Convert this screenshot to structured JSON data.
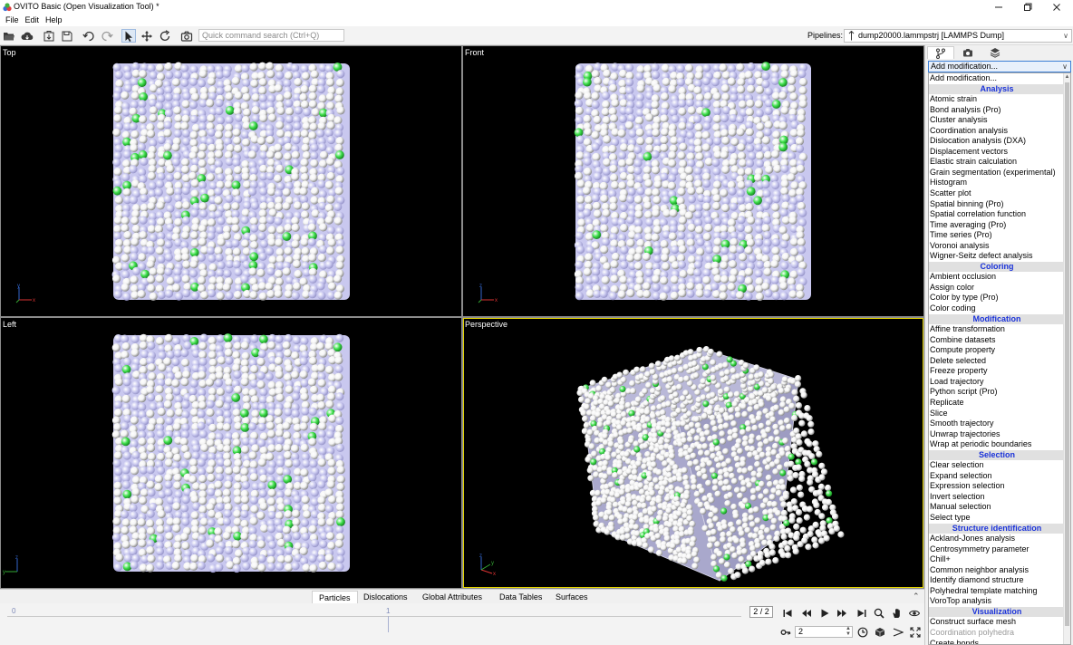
{
  "window": {
    "title": "OVITO Basic (Open Visualization Tool) *",
    "minimize_icon": "minimize-icon",
    "maximize_icon": "maximize-icon",
    "close_icon": "close-icon"
  },
  "menu": [
    "File",
    "Edit",
    "Help"
  ],
  "toolbar": {
    "icons": [
      "open-file-icon",
      "load-remote-icon",
      "export-icon",
      "save-session-icon",
      "undo-icon",
      "redo-icon",
      "select-mode-icon",
      "pan-mode-icon",
      "orbit-mode-icon",
      "render-icon"
    ],
    "search_placeholder": "Quick command search (Ctrl+Q)",
    "pipelines_label": "Pipelines:",
    "pipeline_value": "dump20000.lammpstrj [LAMMPS Dump]"
  },
  "viewports": [
    {
      "caption": "Top",
      "active": false
    },
    {
      "caption": "Front",
      "active": false
    },
    {
      "caption": "Left",
      "active": false
    },
    {
      "caption": "Perspective",
      "active": true
    }
  ],
  "colors": {
    "active_viewport_border": "#e5d600",
    "atom_white": "#f4f4f4",
    "atom_green": "#3ee04b",
    "atom_lavender": "#c9c8ef",
    "viewport_bg": "#000000",
    "category_text": "#1a32d9"
  },
  "inspector_tabs": [
    "Particles",
    "Dislocations",
    "Global Attributes",
    "Data Tables",
    "Surfaces"
  ],
  "inspector_active_tab": "Particles",
  "timeline": {
    "tick_start": "0",
    "tick_end": "1",
    "frame_display": "2 / 2",
    "frame_value": "2"
  },
  "panel": {
    "tab_icons": [
      "pipeline-icon",
      "render-tab-icon",
      "layers-icon"
    ],
    "modifier_select": "Add modification...",
    "list": [
      {
        "label": "Add modification...",
        "type": "item"
      },
      {
        "label": "Analysis",
        "type": "category"
      },
      {
        "label": "Atomic strain",
        "type": "item"
      },
      {
        "label": "Bond analysis (Pro)",
        "type": "item"
      },
      {
        "label": "Cluster analysis",
        "type": "item"
      },
      {
        "label": "Coordination analysis",
        "type": "item"
      },
      {
        "label": "Dislocation analysis (DXA)",
        "type": "item"
      },
      {
        "label": "Displacement vectors",
        "type": "item"
      },
      {
        "label": "Elastic strain calculation",
        "type": "item"
      },
      {
        "label": "Grain segmentation (experimental)",
        "type": "item"
      },
      {
        "label": "Histogram",
        "type": "item"
      },
      {
        "label": "Scatter plot",
        "type": "item"
      },
      {
        "label": "Spatial binning (Pro)",
        "type": "item"
      },
      {
        "label": "Spatial correlation function",
        "type": "item"
      },
      {
        "label": "Time averaging (Pro)",
        "type": "item"
      },
      {
        "label": "Time series (Pro)",
        "type": "item"
      },
      {
        "label": "Voronoi analysis",
        "type": "item"
      },
      {
        "label": "Wigner-Seitz defect analysis",
        "type": "item"
      },
      {
        "label": "Coloring",
        "type": "category"
      },
      {
        "label": "Ambient occlusion",
        "type": "item"
      },
      {
        "label": "Assign color",
        "type": "item"
      },
      {
        "label": "Color by type (Pro)",
        "type": "item"
      },
      {
        "label": "Color coding",
        "type": "item"
      },
      {
        "label": "Modification",
        "type": "category"
      },
      {
        "label": "Affine transformation",
        "type": "item"
      },
      {
        "label": "Combine datasets",
        "type": "item"
      },
      {
        "label": "Compute property",
        "type": "item"
      },
      {
        "label": "Delete selected",
        "type": "item"
      },
      {
        "label": "Freeze property",
        "type": "item"
      },
      {
        "label": "Load trajectory",
        "type": "item"
      },
      {
        "label": "Python script (Pro)",
        "type": "item"
      },
      {
        "label": "Replicate",
        "type": "item"
      },
      {
        "label": "Slice",
        "type": "item"
      },
      {
        "label": "Smooth trajectory",
        "type": "item"
      },
      {
        "label": "Unwrap trajectories",
        "type": "item"
      },
      {
        "label": "Wrap at periodic boundaries",
        "type": "item"
      },
      {
        "label": "Selection",
        "type": "category"
      },
      {
        "label": "Clear selection",
        "type": "item"
      },
      {
        "label": "Expand selection",
        "type": "item"
      },
      {
        "label": "Expression selection",
        "type": "item"
      },
      {
        "label": "Invert selection",
        "type": "item"
      },
      {
        "label": "Manual selection",
        "type": "item"
      },
      {
        "label": "Select type",
        "type": "item"
      },
      {
        "label": "Structure identification",
        "type": "category"
      },
      {
        "label": "Ackland-Jones analysis",
        "type": "item"
      },
      {
        "label": "Centrosymmetry parameter",
        "type": "item"
      },
      {
        "label": "Chill+",
        "type": "item"
      },
      {
        "label": "Common neighbor analysis",
        "type": "item"
      },
      {
        "label": "Identify diamond structure",
        "type": "item"
      },
      {
        "label": "Polyhedral template matching",
        "type": "item"
      },
      {
        "label": "VoroTop analysis",
        "type": "item"
      },
      {
        "label": "Visualization",
        "type": "category"
      },
      {
        "label": "Construct surface mesh",
        "type": "item"
      },
      {
        "label": "Coordination polyhedra",
        "type": "disabled"
      },
      {
        "label": "Create bonds",
        "type": "item"
      }
    ]
  }
}
